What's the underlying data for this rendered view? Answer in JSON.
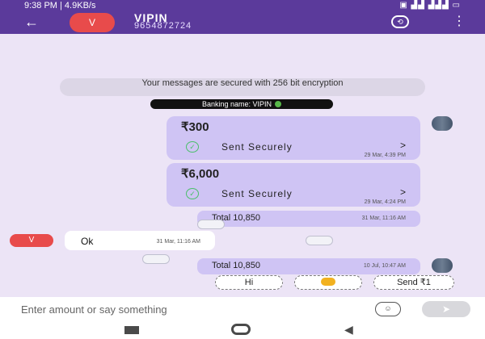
{
  "status_bar": {
    "time_info": "9:38 PM | 4.9KB/s",
    "indicators": "▣ ▟▟ ▟▟▟ ▭"
  },
  "header": {
    "back_glyph": "←",
    "avatar_letter": "V",
    "contact_name": "VIPIN",
    "contact_phone": "9654872724",
    "action_glyph": "⟲",
    "menu_glyph": "⋮"
  },
  "system_message": "Your messages are secured with 256 bit encryption",
  "banking_name": "Banking name: VIPIN",
  "payments": [
    {
      "amount": "₹300",
      "status": "Sent Securely",
      "chevron": ">",
      "check": "✓",
      "time": "29 Mar, 4:39 PM"
    },
    {
      "amount": "₹6,000",
      "status": "Sent Securely",
      "chevron": ">",
      "check": "✓",
      "time": "29 Mar, 4:24 PM"
    }
  ],
  "totals": [
    {
      "label": "Total 10,850",
      "time": "31 Mar, 11:16 AM"
    },
    {
      "label": "Total 10,850",
      "time": "10 Jul, 10:47 AM"
    }
  ],
  "incoming": {
    "avatar_letter": "V",
    "text": "Ok",
    "time": "31 Mar, 11:16 AM"
  },
  "quick_replies": [
    "Hi",
    "",
    "Send ₹1"
  ],
  "composer": {
    "placeholder": "Enter amount or say something",
    "emoji_glyph": "☺",
    "send_glyph": "➤"
  },
  "nav": {
    "back_glyph": "◀"
  },
  "colors": {
    "header": "#5b3a9b",
    "background": "#ece4f6",
    "bubble": "#cfc4f4",
    "avatar": "#e84b4b",
    "check": "#4bbf6b"
  }
}
